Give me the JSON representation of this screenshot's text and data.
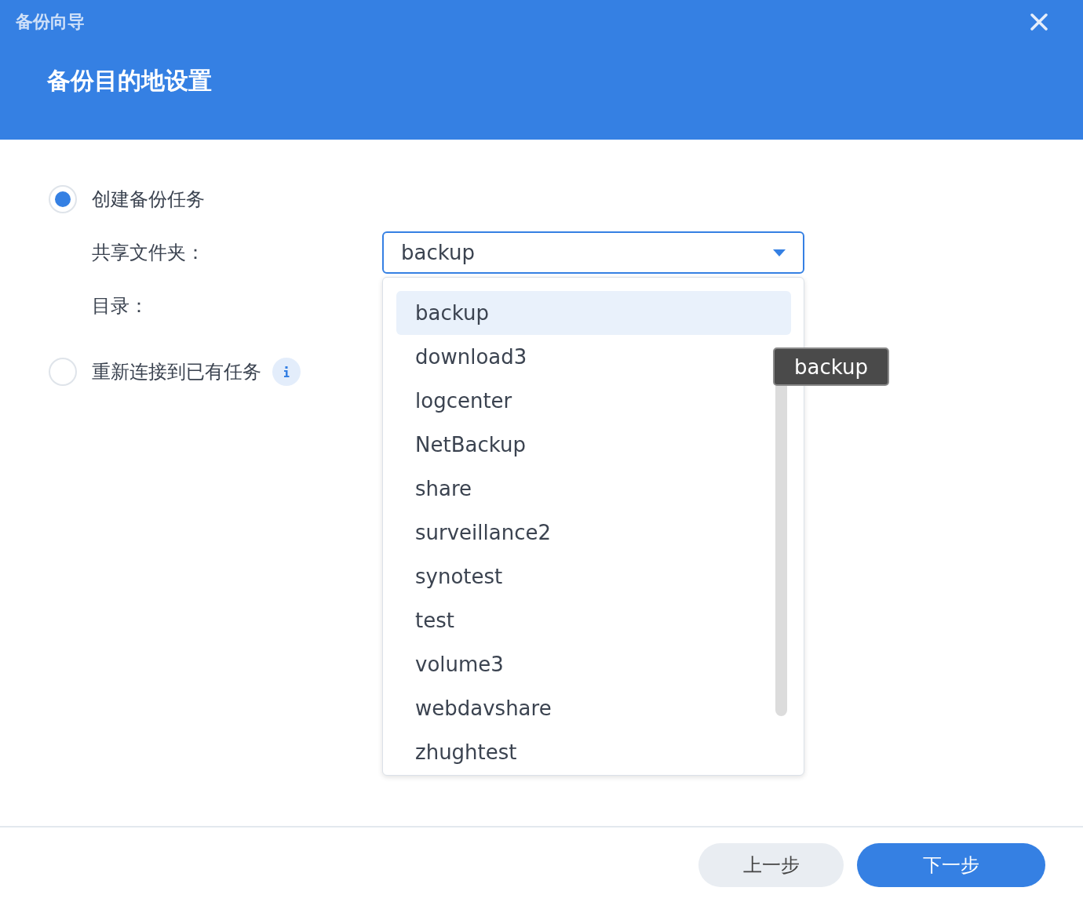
{
  "window": {
    "title": "备份向导"
  },
  "page": {
    "title": "备份目的地设置"
  },
  "options": [
    {
      "label": "创建备份任务",
      "selected": true,
      "fields": [
        {
          "label": "共享文件夹：",
          "kind": "select",
          "value": "backup"
        },
        {
          "label": "目录：",
          "kind": "hidden"
        }
      ]
    },
    {
      "label": "重新连接到已有任务",
      "selected": false,
      "info": true
    }
  ],
  "dropdown": {
    "items": [
      {
        "label": "backup",
        "selected": true
      },
      {
        "label": "download3",
        "selected": false
      },
      {
        "label": "logcenter",
        "selected": false
      },
      {
        "label": "NetBackup",
        "selected": false
      },
      {
        "label": "share",
        "selected": false
      },
      {
        "label": "surveillance2",
        "selected": false
      },
      {
        "label": "synotest",
        "selected": false
      },
      {
        "label": "test",
        "selected": false
      },
      {
        "label": "volume3",
        "selected": false
      },
      {
        "label": "webdavshare",
        "selected": false
      },
      {
        "label": "zhughtest",
        "selected": false
      }
    ]
  },
  "tooltip": "backup",
  "buttons": [
    {
      "label": "上一步",
      "kind": "secondary"
    },
    {
      "label": "下一步",
      "kind": "primary"
    }
  ]
}
